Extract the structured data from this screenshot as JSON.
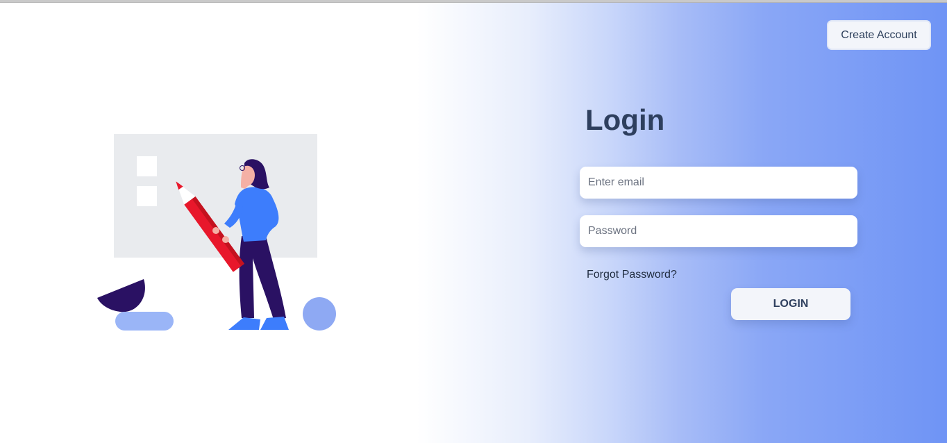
{
  "header": {
    "create_account_label": "Create Account"
  },
  "login": {
    "title": "Login",
    "email_placeholder": "Enter email",
    "email_value": "",
    "password_placeholder": "Password",
    "password_value": "",
    "forgot_label": "Forgot Password?",
    "submit_label": "LOGIN"
  },
  "colors": {
    "accent": "#6f94f5",
    "title_text": "#2e3f5e",
    "pencil": "#e8172b",
    "figure_shirt": "#3d7dfc",
    "figure_pants": "#2a1163"
  },
  "illustration": {
    "icon": "person-with-pencil-illustration"
  }
}
